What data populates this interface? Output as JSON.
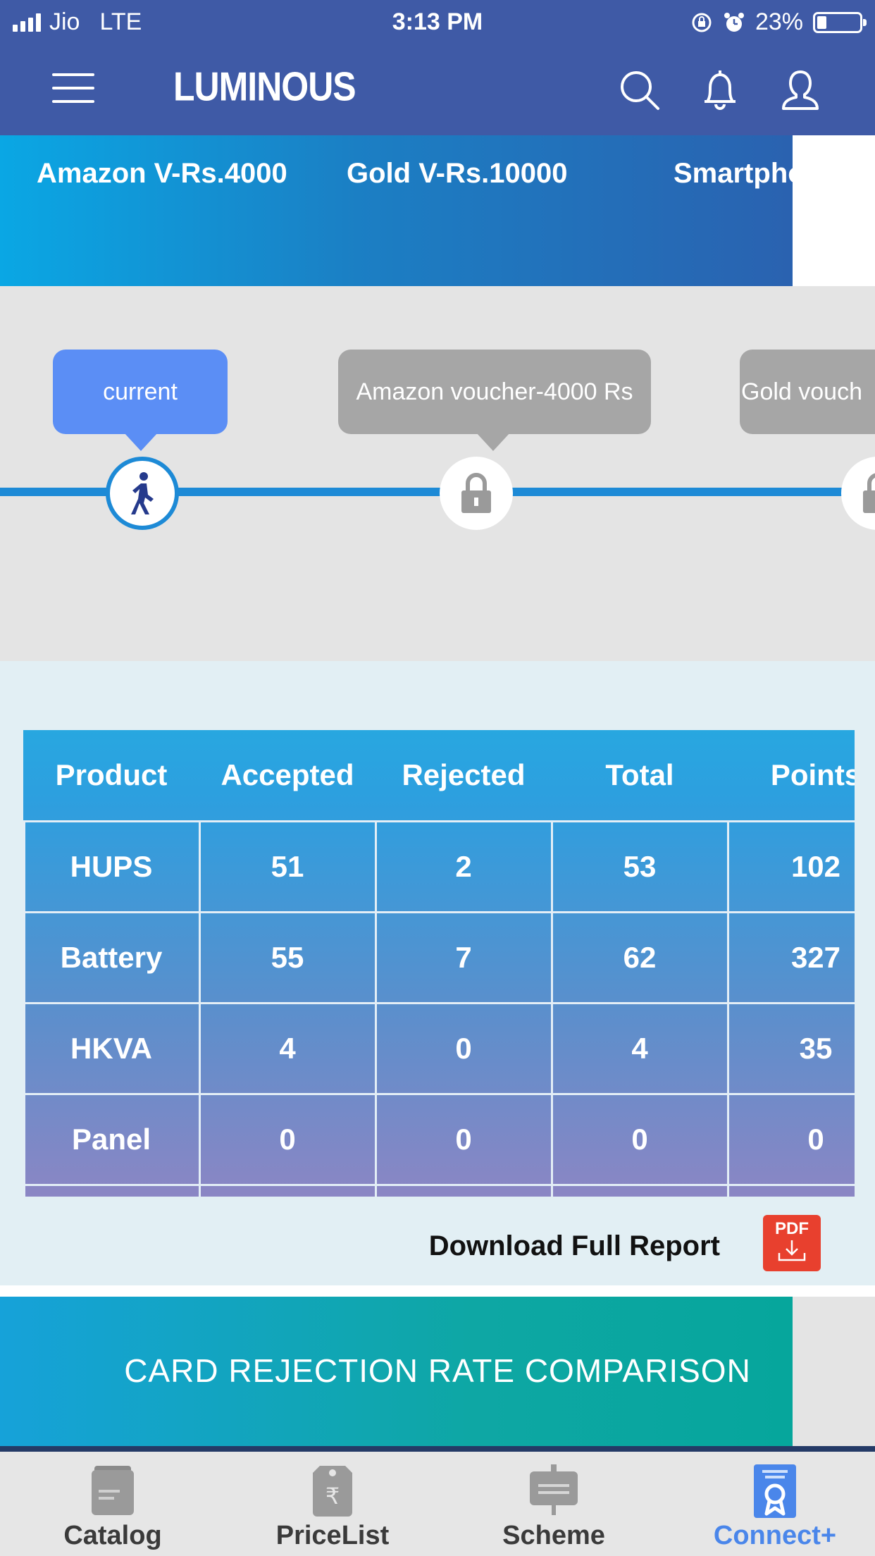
{
  "status_bar": {
    "carrier": "Jio",
    "network": "LTE",
    "time": "3:13 PM",
    "battery": "23%",
    "battery_level": 0.23
  },
  "header": {
    "logo": "LUMINOUS"
  },
  "rewards": {
    "items": [
      "Amazon V-Rs.4000",
      "Gold V-Rs.10000",
      "Smartpho"
    ]
  },
  "progress": {
    "current_label": "current",
    "milestones": [
      "Amazon voucher-4000 Rs",
      "Gold vouch"
    ]
  },
  "table": {
    "headers": [
      "Product",
      "Accepted",
      "Rejected",
      "Total",
      "Points"
    ],
    "rows": [
      [
        "HUPS",
        "51",
        "2",
        "53",
        "102"
      ],
      [
        "Battery",
        "55",
        "7",
        "62",
        "327"
      ],
      [
        "HKVA",
        "4",
        "0",
        "4",
        "35"
      ],
      [
        "Panel",
        "0",
        "0",
        "0",
        "0"
      ]
    ]
  },
  "download": {
    "label": "Download Full Report",
    "pdf_label": "PDF"
  },
  "section": {
    "title": "CARD REJECTION RATE COMPARISON"
  },
  "tabs": [
    {
      "label": "Catalog",
      "icon": "catalog-icon"
    },
    {
      "label": "PriceList",
      "icon": "price-tag-icon"
    },
    {
      "label": "Scheme",
      "icon": "scheme-board-icon"
    },
    {
      "label": "Connect+",
      "icon": "certificate-icon",
      "active": true
    }
  ],
  "colors": {
    "header": "#3f5aa6",
    "accent": "#4a86ea",
    "track": "#1d8ad6",
    "pdf": "#e8402e"
  }
}
